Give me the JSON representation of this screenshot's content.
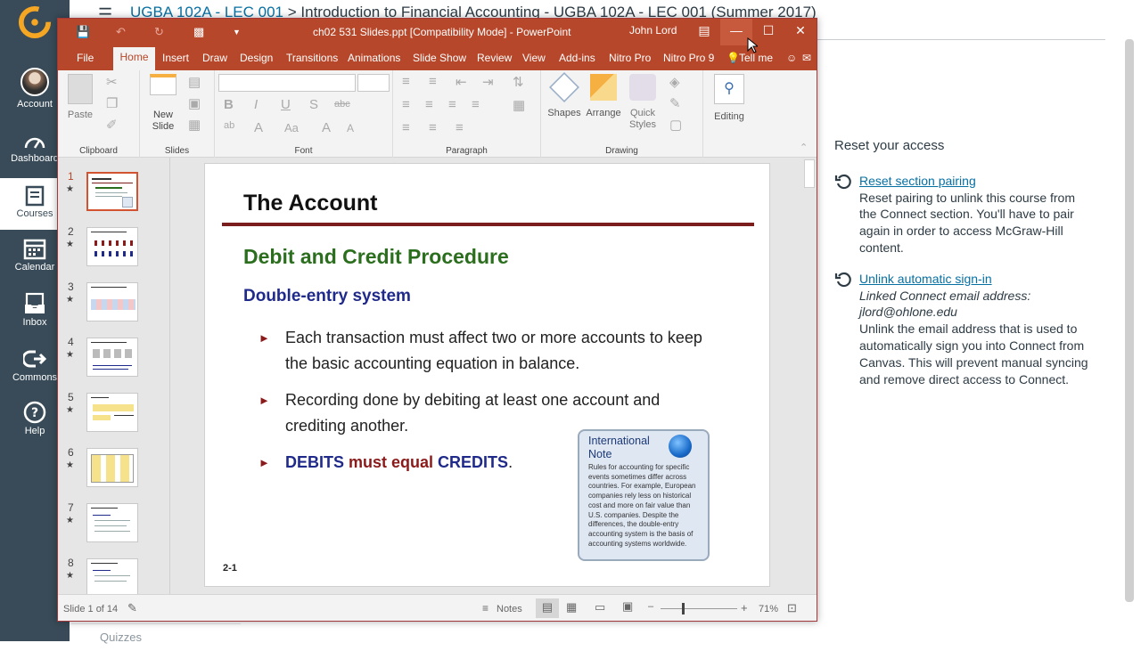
{
  "canvas": {
    "nav": [
      {
        "label": "Account",
        "icon": "avatar"
      },
      {
        "label": "Dashboard",
        "icon": "speedometer-icon"
      },
      {
        "label": "Courses",
        "icon": "courses-icon"
      },
      {
        "label": "Calendar",
        "icon": "calendar-icon"
      },
      {
        "label": "Inbox",
        "icon": "inbox-icon"
      },
      {
        "label": "Commons",
        "icon": "commons-icon"
      },
      {
        "label": "Help",
        "icon": "help-icon"
      }
    ],
    "breadcrumb": {
      "course": "UGBA 102A - LEC 001",
      "separator": ">",
      "page": "Introduction to Financial Accounting - UGBA 102A - LEC 001 (Summer 2017)"
    },
    "side_item": "Quizzes",
    "reset": {
      "heading": "Reset your access",
      "option1": {
        "title": "Reset section pairing",
        "desc": "Reset pairing to unlink this course from the Connect section. You'll have to pair again in order to access McGraw-Hill content."
      },
      "option2": {
        "title": "Unlink automatic sign-in",
        "linked_label": "Linked Connect email address:",
        "email": "jlord@ohlone.edu",
        "desc": "Unlink the email address that is used to automatically sign you into Connect from Canvas. This will prevent manual syncing and remove direct access to Connect."
      }
    }
  },
  "ppt": {
    "doc_title": "ch02 531 Slides.ppt [Compatibility Mode]  -  PowerPoint",
    "user": "John Lord",
    "tabs": [
      "File",
      "Home",
      "Insert",
      "Draw",
      "Design",
      "Transitions",
      "Animations",
      "Slide Show",
      "Review",
      "View",
      "Add-ins",
      "Nitro Pro",
      "Nitro Pro 9",
      "Tell me"
    ],
    "ribbon": {
      "paste": "Paste",
      "new_slide": "New",
      "new_slide2": "Slide",
      "shapes": "Shapes",
      "arrange": "Arrange",
      "quick_styles": "Quick",
      "quick_styles2": "Styles",
      "editing": "Editing",
      "groups": [
        "Clipboard",
        "Slides",
        "Font",
        "Paragraph",
        "Drawing"
      ]
    },
    "thumbs": [
      "1",
      "2",
      "3",
      "4",
      "5",
      "6",
      "7",
      "8"
    ],
    "slide": {
      "title": "The Account",
      "heading": "Debit and Credit Procedure",
      "subheading": "Double-entry system",
      "bullet1": "Each transaction must affect two or more accounts to keep the basic accounting equation in balance.",
      "bullet2": "Recording done by debiting at least one account and crediting another.",
      "bullet3_a": "DEBITS",
      "bullet3_b": " must equal ",
      "bullet3_c": "CREDITS",
      "bullet3_d": ".",
      "page_number": "2-1",
      "note_title": "International Note",
      "note_body": "Rules for accounting for specific events sometimes differ across countries. For example, European companies rely less on historical cost and more on fair value than U.S. companies. Despite the differences, the double-entry accounting system is the basis of accounting systems worldwide."
    },
    "status": {
      "slide_count": "Slide 1 of 14",
      "notes": "Notes",
      "zoom": "71%"
    }
  }
}
